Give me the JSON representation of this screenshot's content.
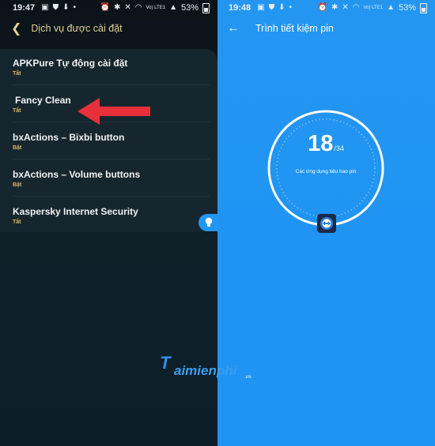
{
  "left": {
    "status": {
      "time": "19:47",
      "battery": "53%",
      "network": "Vo) LTE1"
    },
    "header": {
      "title": "Dịch vụ được cài đặt"
    },
    "services": [
      {
        "name": "APKPure Tự động cài đặt",
        "state": "Tắt"
      },
      {
        "name": "Fancy Clean",
        "state": "Tắt"
      },
      {
        "name": "bxActions – Bixbi button",
        "state": "Bật"
      },
      {
        "name": "bxActions – Volume buttons",
        "state": "Bật"
      },
      {
        "name": "Kaspersky Internet Security",
        "state": "Tắt"
      }
    ],
    "colors": {
      "title": "#e6cf94",
      "state": "#e1b966",
      "arrow": "#e8303a"
    }
  },
  "right": {
    "status": {
      "time": "19:48",
      "battery": "53%",
      "network": "Vo) LTE1"
    },
    "header": {
      "title": "Trình tiết kiệm pin"
    },
    "counter": {
      "value": "18",
      "total": "/34",
      "caption": "Các ứng dụng tiêu hao pin"
    },
    "colors": {
      "background": "#2196f3"
    }
  },
  "watermark": {
    "text": "aimienphi",
    "mark": "T",
    "sub": ".vn"
  }
}
